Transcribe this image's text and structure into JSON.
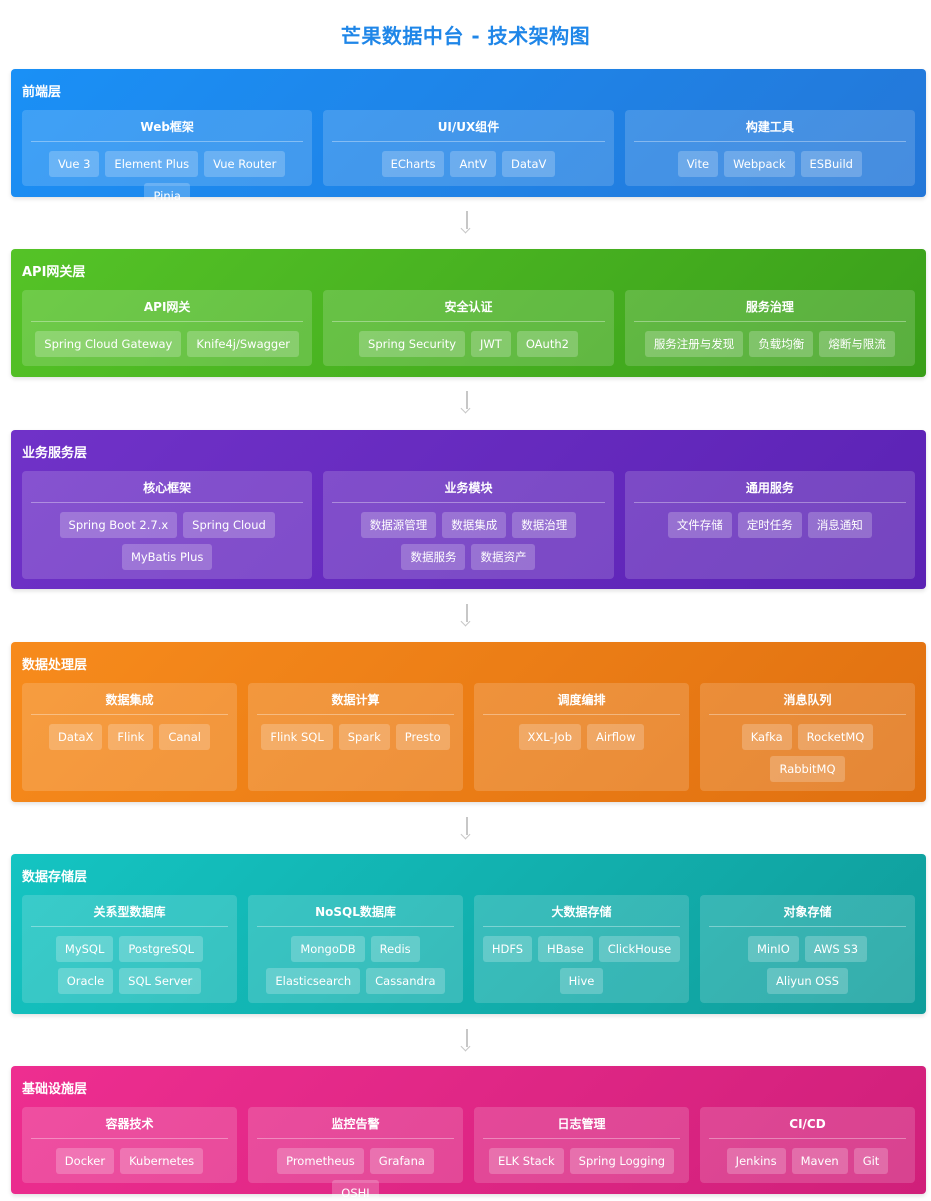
{
  "title": "芒果数据中台 - 技术架构图",
  "layers": [
    {
      "name": "前端层",
      "color_from": "#1a90f6",
      "color_to": "#2477d8",
      "modules": [
        {
          "title": "Web框架",
          "tags": [
            "Vue 3",
            "Element Plus",
            "Vue Router",
            "Pinia"
          ]
        },
        {
          "title": "UI/UX组件",
          "tags": [
            "ECharts",
            "AntV",
            "DataV"
          ]
        },
        {
          "title": "构建工具",
          "tags": [
            "Vite",
            "Webpack",
            "ESBuild"
          ]
        }
      ]
    },
    {
      "name": "API网关层",
      "color_from": "#55c327",
      "color_to": "#3a9f1a",
      "modules": [
        {
          "title": "API网关",
          "tags": [
            "Spring Cloud Gateway",
            "Knife4j/Swagger"
          ]
        },
        {
          "title": "安全认证",
          "tags": [
            "Spring Security",
            "JWT",
            "OAuth2"
          ]
        },
        {
          "title": "服务治理",
          "tags": [
            "服务注册与发现",
            "负载均衡",
            "熔断与限流"
          ]
        }
      ]
    },
    {
      "name": "业务服务层",
      "color_from": "#7032c8",
      "color_to": "#5b22b4",
      "modules": [
        {
          "title": "核心框架",
          "tags": [
            "Spring Boot 2.7.x",
            "Spring Cloud",
            "MyBatis Plus"
          ]
        },
        {
          "title": "业务模块",
          "tags": [
            "数据源管理",
            "数据集成",
            "数据治理",
            "数据服务",
            "数据资产"
          ]
        },
        {
          "title": "通用服务",
          "tags": [
            "文件存储",
            "定时任务",
            "消息通知"
          ]
        }
      ]
    },
    {
      "name": "数据处理层",
      "color_from": "#f78b1c",
      "color_to": "#e07010",
      "modules": [
        {
          "title": "数据集成",
          "tags": [
            "DataX",
            "Flink",
            "Canal"
          ]
        },
        {
          "title": "数据计算",
          "tags": [
            "Flink SQL",
            "Spark",
            "Presto"
          ]
        },
        {
          "title": "调度编排",
          "tags": [
            "XXL-Job",
            "Airflow"
          ]
        },
        {
          "title": "消息队列",
          "tags": [
            "Kafka",
            "RocketMQ",
            "RabbitMQ"
          ]
        }
      ]
    },
    {
      "name": "数据存储层",
      "color_from": "#14c4c2",
      "color_to": "#109d9b",
      "modules": [
        {
          "title": "关系型数据库",
          "tags": [
            "MySQL",
            "PostgreSQL",
            "Oracle",
            "SQL Server"
          ]
        },
        {
          "title": "NoSQL数据库",
          "tags": [
            "MongoDB",
            "Redis",
            "Elasticsearch",
            "Cassandra"
          ]
        },
        {
          "title": "大数据存储",
          "tags": [
            "HDFS",
            "HBase",
            "ClickHouse",
            "Hive"
          ]
        },
        {
          "title": "对象存储",
          "tags": [
            "MinIO",
            "AWS S3",
            "Aliyun OSS"
          ]
        }
      ]
    },
    {
      "name": "基础设施层",
      "color_from": "#ee2e90",
      "color_to": "#d01f7a",
      "modules": [
        {
          "title": "容器技术",
          "tags": [
            "Docker",
            "Kubernetes"
          ]
        },
        {
          "title": "监控告警",
          "tags": [
            "Prometheus",
            "Grafana",
            "OSHI"
          ]
        },
        {
          "title": "日志管理",
          "tags": [
            "ELK Stack",
            "Spring Logging"
          ]
        },
        {
          "title": "CI/CD",
          "tags": [
            "Jenkins",
            "Maven",
            "Git"
          ]
        }
      ]
    }
  ]
}
